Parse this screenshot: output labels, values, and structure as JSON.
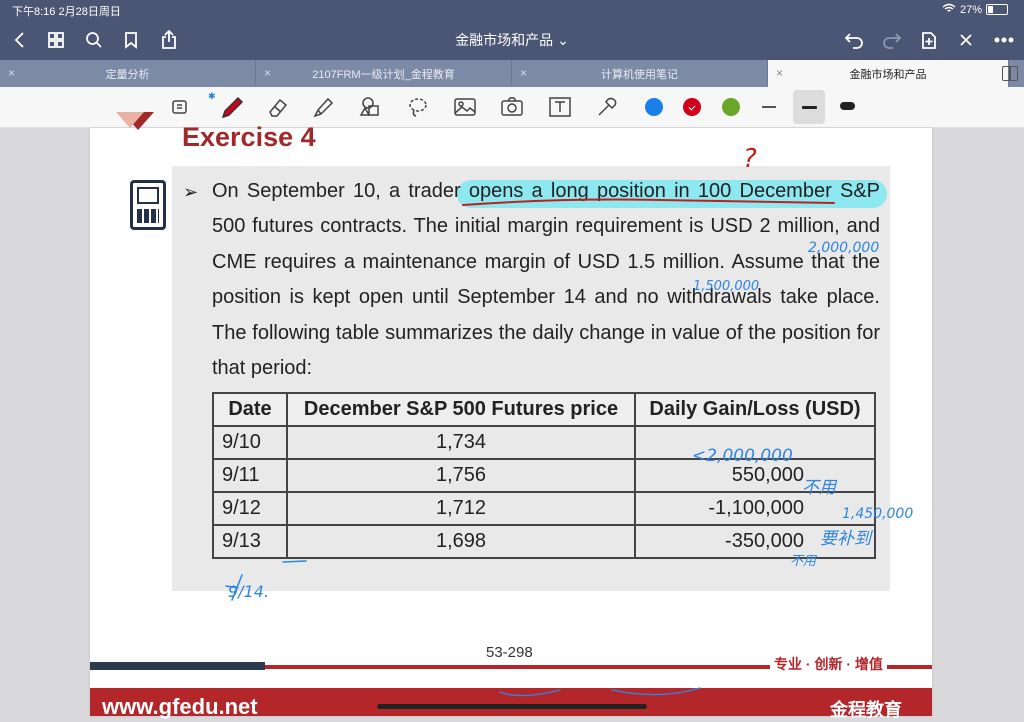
{
  "status": {
    "time_date": "下午8:16  2月28日周日",
    "battery": "27%",
    "battery_level": 0.27
  },
  "navbar": {
    "doc_title": "金融市场和产品",
    "chevron": "⌄",
    "icons": [
      "back-icon",
      "grid-icon",
      "search-icon",
      "bookmark-icon",
      "share-icon",
      "undo-icon",
      "redo-icon",
      "add-page-icon",
      "close-icon",
      "more-icon"
    ]
  },
  "tabs": [
    {
      "label": "定量分析",
      "active": false
    },
    {
      "label": "2107FRM一级计划_金程教育",
      "active": false
    },
    {
      "label": "计算机使用笔记",
      "active": false
    },
    {
      "label": "金融市场和产品",
      "active": true
    }
  ],
  "toolbar": {
    "tools": [
      "lasso-select-icon",
      "pen-icon",
      "eraser-icon",
      "highlighter-icon",
      "shapes-icon",
      "lasso-icon",
      "image-icon",
      "camera-icon",
      "text-icon",
      "elements-icon"
    ],
    "colors": [
      "#1a7fe8",
      "#d0021b",
      "#6aa628"
    ],
    "selected_color": "#d0021b",
    "bluetooth_mark": "✱"
  },
  "slide": {
    "title": "Exercise 4",
    "bullet": "➢",
    "paragraph": "On September 10, a trader opens a long position in 100 December S&P 500 futures contracts. The initial margin requirement is USD 2 million, and CME requires a maintenance margin of USD 1.5 million. Assume that the position is kept open until September 14 and no withdrawals take place. The following table summarizes the daily change in value of the position for that period:",
    "table": {
      "headers": [
        "Date",
        "December S&P 500 Futures price",
        "Daily Gain/Loss (USD)"
      ],
      "rows": [
        [
          "9/10",
          "1,734",
          ""
        ],
        [
          "9/11",
          "1,756",
          "550,000"
        ],
        [
          "9/12",
          "1,712",
          "-1,100,000"
        ],
        [
          "9/13",
          "1,698",
          "-350,000"
        ]
      ]
    },
    "page_number": "53-298",
    "slogan": "专业 · 创新 · 增值",
    "next_site": "www.gfedu.net",
    "next_brand": "金程教育"
  },
  "handwriting": {
    "question_mark": "?",
    "initial_margin_note": "2,000,000",
    "maintenance_note": "1,500,000",
    "row1_note": "<2,000,000",
    "row2_note": "不用",
    "row3_note_top": "1,450,000",
    "row3_note_bottom": "要补到",
    "row4_note": "不用",
    "date_note": "9/14."
  }
}
